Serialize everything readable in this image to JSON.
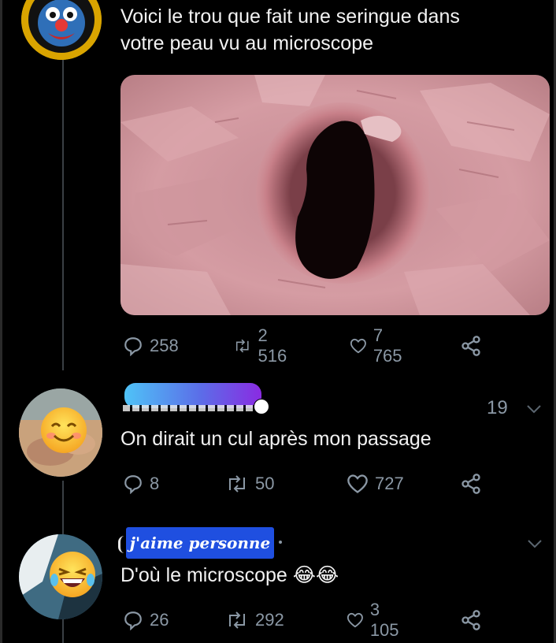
{
  "tweets": [
    {
      "text_line1": "Voici le trou que fait une seringue dans",
      "text_line2": "votre peau vu au microscope",
      "replies": "258",
      "retweets": "2 516",
      "likes": "7 765"
    },
    {
      "time": "19",
      "text": "On dirait un cul après mon passage",
      "replies": "8",
      "retweets": "50",
      "likes": "727"
    },
    {
      "name_label": "j'aime personne",
      "text": "D'où le microscope 😂😂",
      "replies": "26",
      "retweets": "292",
      "likes": "3 105"
    }
  ],
  "colors": {
    "background": "#000000",
    "text": "#f2f2f2",
    "muted": "#8b98a5",
    "label_bg": "#1f4fe0",
    "gradient_start": "#4fc3f7",
    "gradient_end": "#8a2be2"
  },
  "icons": [
    "reply-icon",
    "retweet-icon",
    "like-icon",
    "share-icon",
    "chevron-down-icon",
    "smiling-emoji-icon",
    "laughing-emoji-icon"
  ]
}
